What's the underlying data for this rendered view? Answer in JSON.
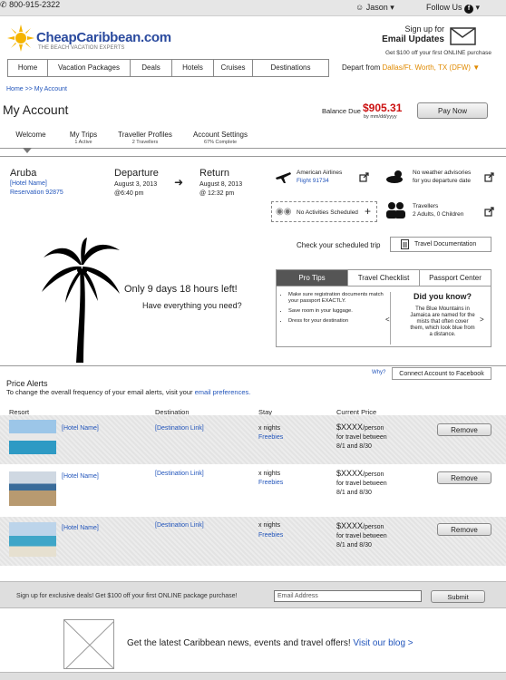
{
  "topbar": {
    "phone": "800-915-2322",
    "user": "Jason",
    "follow": "Follow Us"
  },
  "brand": {
    "name": "CheapCaribbean.com",
    "tagline": "THE BEACH VACATION EXPERTS",
    "signup_line1": "Sign up for",
    "signup_line2": "Email Updates",
    "promo": "Get $100 off your first ONLINE purchase"
  },
  "nav": [
    "Home",
    "Vacation Packages",
    "Deals",
    "Hotels",
    "Cruises",
    "Destinations"
  ],
  "depart": {
    "label": "Depart from",
    "city": "Dallas/Ft. Worth, TX (DFW)"
  },
  "breadcrumb": "Home >> My Account",
  "page_title": "My Account",
  "balance": {
    "label": "Balance Due",
    "amount": "$905.31",
    "sub": "by mm/dd/yyyy",
    "pay": "Pay Now"
  },
  "tabs": [
    {
      "label": "Welcome",
      "sub": ""
    },
    {
      "label": "My Trips",
      "sub": "1 Active"
    },
    {
      "label": "Traveller Profiles",
      "sub": "2 Travellers"
    },
    {
      "label": "Account Settings",
      "sub": "67% Complete"
    }
  ],
  "trip": {
    "destination": "Aruba",
    "hotel": "[Hotel Name]",
    "reservation": "Reservation 92875",
    "departure_title": "Departure",
    "departure_date": "August 3, 2013",
    "departure_time": "@6:40 pm",
    "return_title": "Return",
    "return_date": "August 8, 2013",
    "return_time": "@ 12:32 pm",
    "airline": "American Airlines",
    "flight": "Flight 91734",
    "weather1": "No weather advisories",
    "weather2": "for you departure date",
    "activities": "No Activities Scheduled",
    "travellers": "Travellers",
    "travellers_count": "2 Adults, 0 Children",
    "check": "Check your scheduled trip",
    "travel_doc": "Travel Documentation",
    "countdown": "Only 9 days 18 hours left!",
    "have": "Have everything you need?"
  },
  "tips": {
    "tabs": [
      "Pro Tips",
      "Travel Checklist",
      "Passport Center"
    ],
    "items": [
      "Make sure registration documents match your passport EXACTLY.",
      "Save room in your luggage.",
      "Dress for your destination"
    ],
    "dyk_title": "Did you know?",
    "dyk_text": "The Blue Mountains in Jamaica are named for the mists that often cover them, which look blue from a distance."
  },
  "alerts": {
    "why": "Why?",
    "connect": "Connect Account to Facebook",
    "title": "Price Alerts",
    "subtitle": "To change the overall frequency of your email alerts, visit your",
    "sublink": "email preferences.",
    "headers": [
      "Resort",
      "Destination",
      "Stay",
      "Current Price"
    ],
    "rows": [
      {
        "hotel": "[Hotel Name]",
        "dest": "[Destination Link]",
        "stay": "x nights",
        "freebies": "Freebies",
        "price": "$XXXX",
        "per": "/person",
        "between": "for travel between",
        "dates": "8/1 and 8/30",
        "remove": "Remove"
      },
      {
        "hotel": "[Hotel Name]",
        "dest": "[Destination Link]",
        "stay": "x nights",
        "freebies": "Freebies",
        "price": "$XXXX",
        "per": "/person",
        "between": "for travel between",
        "dates": "8/1 and 8/30",
        "remove": "Remove"
      },
      {
        "hotel": "[Hotel Name]",
        "dest": "[Destination Link]",
        "stay": "x nights",
        "freebies": "Freebies",
        "price": "$XXXX",
        "per": "/person",
        "between": "for travel between",
        "dates": "8/1 and 8/30",
        "remove": "Remove"
      }
    ]
  },
  "footer": {
    "deal": "Sign up for exclusive deals! Get $100 off your first ONLINE package purchase!",
    "email_placeholder": "Email Address",
    "submit": "Submit",
    "blog_text": "Get the latest Caribbean news, events and travel offers!",
    "blog_link": "Visit our blog >"
  }
}
